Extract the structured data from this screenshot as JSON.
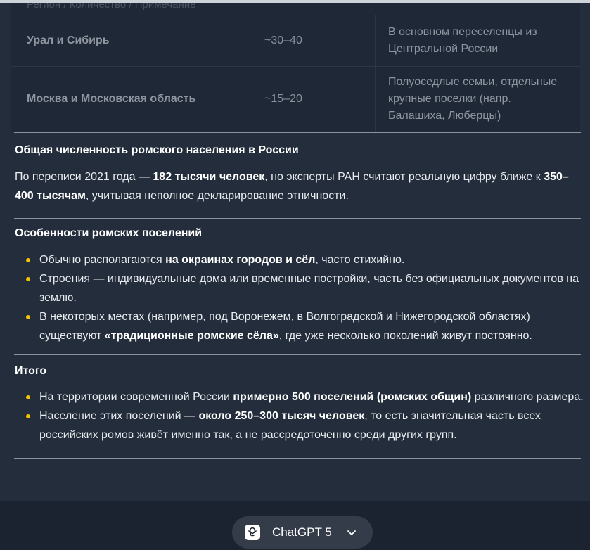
{
  "table": {
    "faded_heading": "Регион / Количество / Примечание",
    "rows": [
      {
        "region": "Урал и Сибирь",
        "count": "~30–40",
        "note_lines": [
          "В основном переселенцы из",
          "Центральной России"
        ]
      },
      {
        "region": "Москва и Московская область",
        "count": "~15–20",
        "note_lines": [
          "Полуоседлые семьи, отдельные",
          "крупные поселки (напр.",
          "Балашиха, Люберцы)"
        ]
      }
    ]
  },
  "section_total": {
    "title": "Общая численность ромского населения в России",
    "p_a": "По переписи 2021 года — ",
    "p_b": "182 тысячи человек",
    "p_c": ", но эксперты РАН считают реальную цифру ближе к ",
    "p_d": "350–400 тысячам",
    "p_e": ", учитывая неполное декларирование этничности."
  },
  "section_features": {
    "title": "Особенности ромских поселений",
    "b1_a": "Обычно располагаются ",
    "b1_b": "на окраинах городов и сёл",
    "b1_c": ", часто стихийно.",
    "b2": "Строения — индивидуальные дома или временные постройки, часть без официальных документов на землю.",
    "b3_a": "В некоторых местах (например, под Воронежем, в Волгоградской и Нижегородской областях) существуют ",
    "b3_b": "«традиционные ромские сёла»",
    "b3_c": ", где уже несколько поколений живут постоянно."
  },
  "section_summary": {
    "title": "Итого",
    "b1_a": "На территории современной России ",
    "b1_b": "примерно 500 поселений (ромских общин)",
    "b1_c": " различного размера.",
    "b2_a": "Население этих поселений — ",
    "b2_b": "около 250–300 тысяч человек",
    "b2_c": ", то есть значительная часть всех российских ромов живёт именно так, а не рассредоточенно среди других групп."
  },
  "model_selector": {
    "label": "ChatGPT 5",
    "logo_icon": "openai-logo-icon",
    "chevron_icon": "chevron-down-icon"
  },
  "colors": {
    "background": "#232d3b",
    "bullet": "#f3c200",
    "text": "#e8ebef"
  }
}
